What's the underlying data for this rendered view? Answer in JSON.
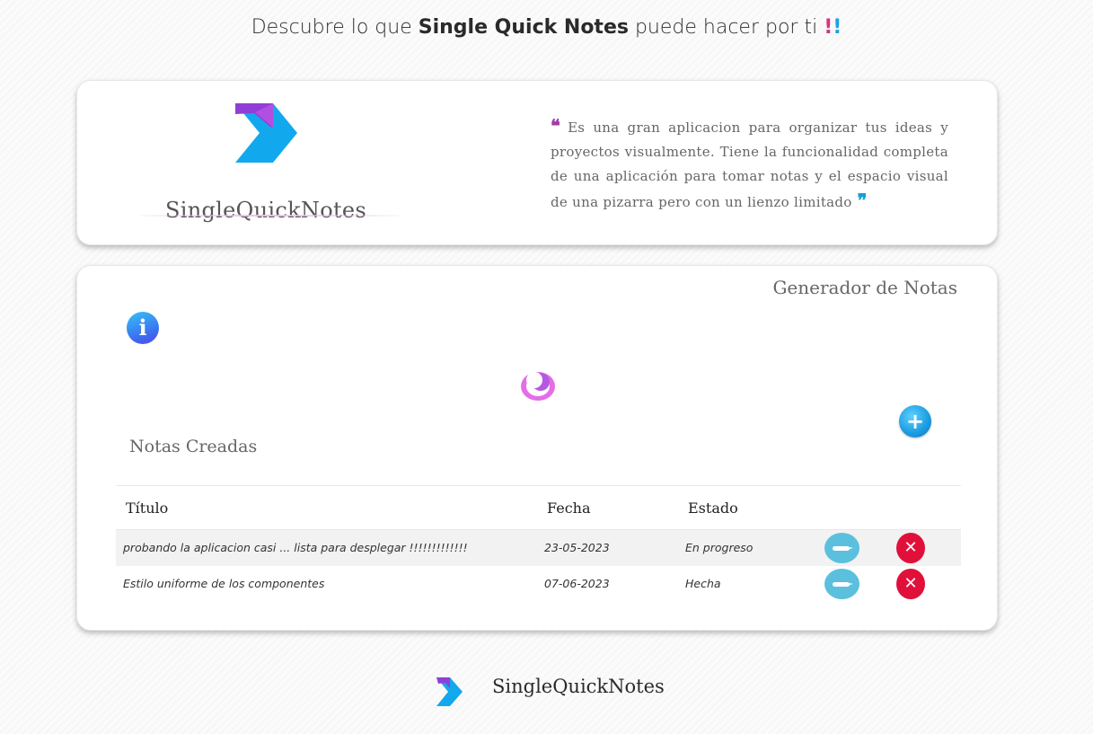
{
  "header": {
    "prefix": "Descubre lo que ",
    "brand": "Single Quick Notes",
    "suffix": " puede hacer por ti ",
    "bang1": "!",
    "bang2": "!"
  },
  "intro": {
    "logo_text": "SingleQuickNotes",
    "quote": "Es una gran aplicacion para organizar tus ideas y proyectos visualmente. Tiene la funcionalidad completa de una aplicación para tomar notas y el espacio visual de una pizarra pero con un lienzo limitado",
    "open_mark": "❝",
    "close_mark": "❞"
  },
  "generator": {
    "title": "Generador de Notas",
    "info_icon_glyph": "i",
    "add_icon_glyph": "+",
    "notes_heading": "Notas Creadas"
  },
  "table": {
    "headers": [
      "Título",
      "Fecha",
      "Estado"
    ],
    "rows": [
      {
        "titulo": "probando la aplicacion casi ... lista para desplegar !!!!!!!!!!!!!",
        "fecha": "23-05-2023",
        "estado": "En progreso"
      },
      {
        "titulo": "Estilo uniforme de los componentes",
        "fecha": "07-06-2023",
        "estado": "Hecha"
      }
    ],
    "delete_glyph": "✕"
  },
  "footer": {
    "brand": "SingleQuickNotes"
  },
  "colors": {
    "accent_blue": "#1ea0e6",
    "accent_purple": "#a23ba8",
    "edit": "#5bc0de",
    "delete": "#e0103a"
  },
  "icons": {
    "logo": "chevron-logo-icon",
    "info": "info-icon",
    "theme": "moon-icon",
    "add": "plus-icon",
    "edit": "edit-icon",
    "delete": "close-icon"
  }
}
